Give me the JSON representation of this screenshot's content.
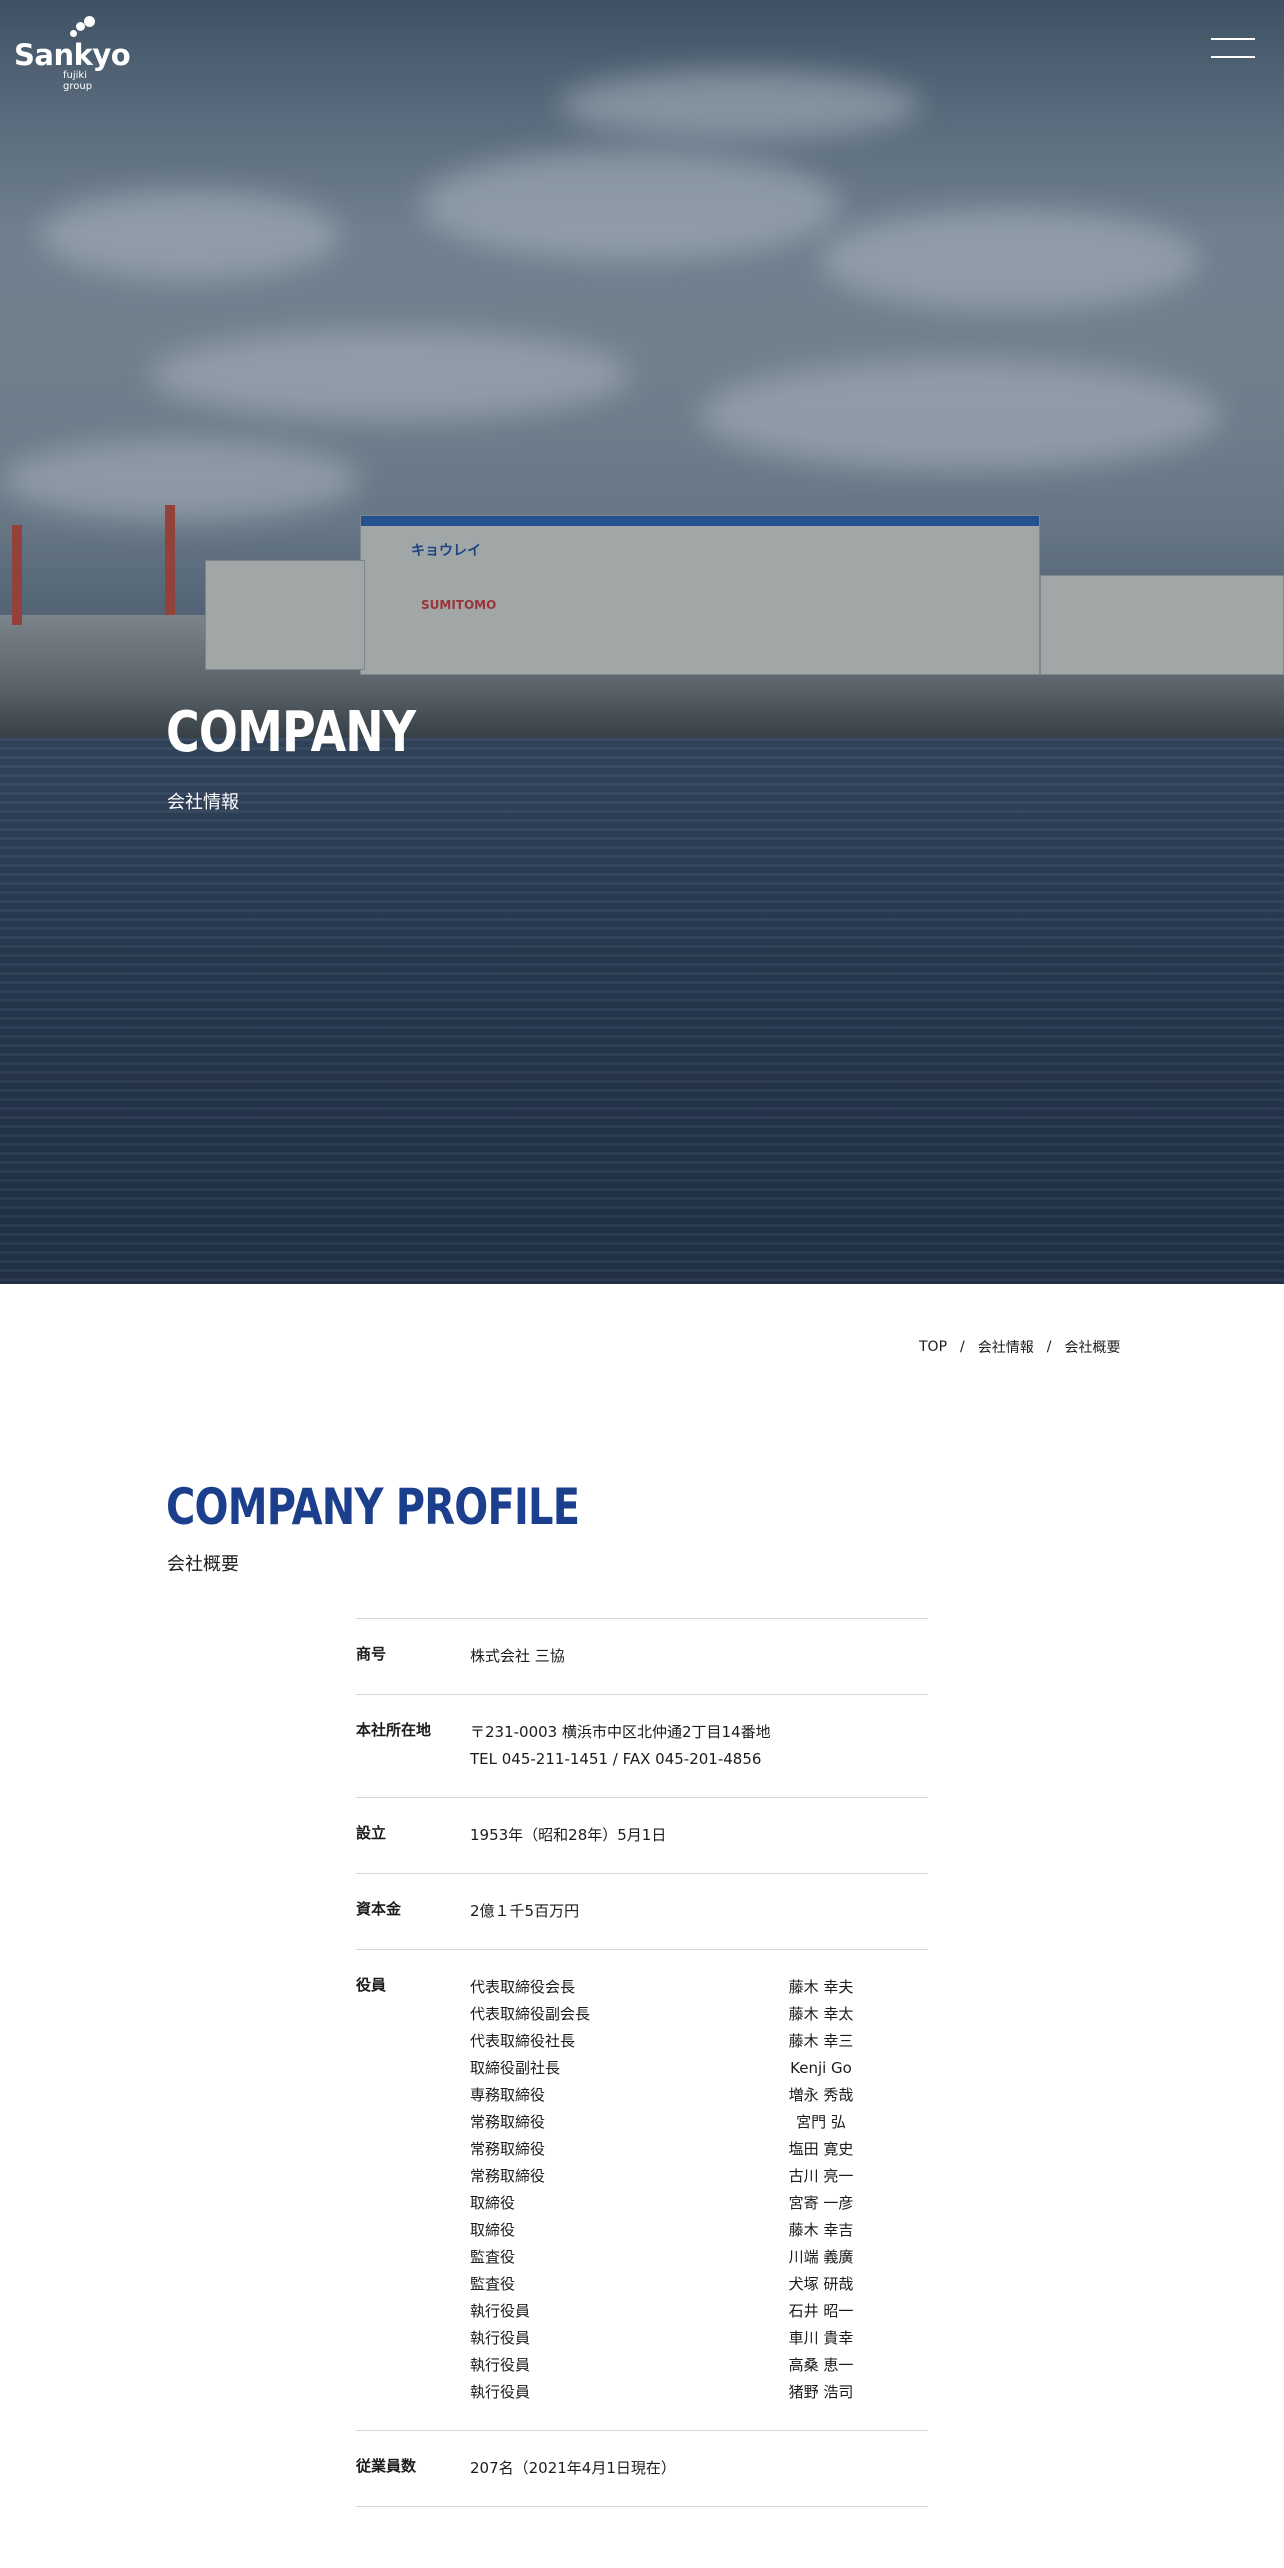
{
  "header": {
    "logo_text": "Sankyo",
    "logo_sub": "fujiki group",
    "menu_icon": "hamburger-menu-icon"
  },
  "hero": {
    "title": "COMPANY",
    "subtitle": "会社情報",
    "warehouse_sign_1": "キョウレイ",
    "warehouse_sign_2": "SUMITOMO"
  },
  "breadcrumb": {
    "items": [
      "TOP",
      "会社情報",
      "会社概要"
    ],
    "separator": "/"
  },
  "section": {
    "title": "COMPANY PROFILE",
    "subtitle": "会社概要"
  },
  "profile": {
    "trade_name": {
      "label": "商号",
      "value": "株式会社 三協"
    },
    "head_office": {
      "label": "本社所在地",
      "address": "〒231-0003 横浜市中区北仲通2丁目14番地",
      "tel": "TEL 045-211-1451 / FAX 045-201-4856"
    },
    "established": {
      "label": "設立",
      "value": "1953年（昭和28年）5月1日"
    },
    "capital": {
      "label": "資本金",
      "value": "2億１千5百万円"
    },
    "officers": {
      "label": "役員",
      "list": [
        {
          "title": "代表取締役会長",
          "name": "藤木 幸夫"
        },
        {
          "title": "代表取締役副会長",
          "name": "藤木 幸太"
        },
        {
          "title": "代表取締役社長",
          "name": "藤木 幸三"
        },
        {
          "title": "取締役副社長",
          "name": "Kenji Go"
        },
        {
          "title": "専務取締役",
          "name": "増永 秀哉"
        },
        {
          "title": "常務取締役",
          "name": "宮門 弘"
        },
        {
          "title": "常務取締役",
          "name": "塩田 寛史"
        },
        {
          "title": "常務取締役",
          "name": "古川 亮一"
        },
        {
          "title": "取締役",
          "name": "宮寄 一彦"
        },
        {
          "title": "取締役",
          "name": "藤木 幸吉"
        },
        {
          "title": "監査役",
          "name": "川端 義廣"
        },
        {
          "title": "監査役",
          "name": "犬塚 研哉"
        },
        {
          "title": "執行役員",
          "name": "石井 昭一"
        },
        {
          "title": "執行役員",
          "name": "車川 貴幸"
        },
        {
          "title": "執行役員",
          "name": "高桑 恵一"
        },
        {
          "title": "執行役員",
          "name": "猪野 浩司"
        }
      ]
    },
    "employees": {
      "label": "従業員数",
      "value": "207名（2021年4月1日現在）"
    }
  },
  "colors": {
    "accent": "#1b3f8c",
    "text": "#1c1c1c",
    "divider": "#d3d6da"
  }
}
